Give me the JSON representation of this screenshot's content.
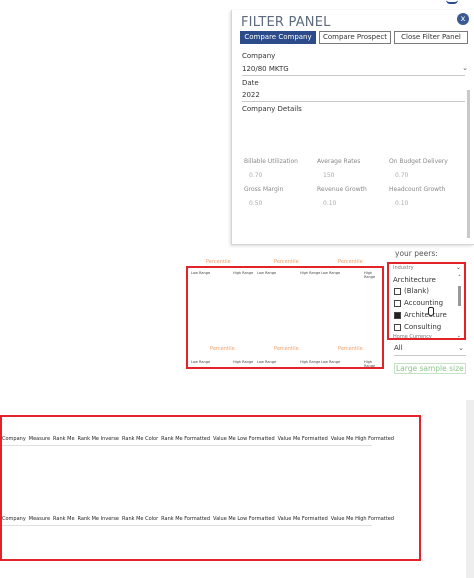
{
  "filter_panel": {
    "title": "FILTER PANEL",
    "close_label": "x",
    "tabs": [
      {
        "label": "Compare Company",
        "active": true
      },
      {
        "label": "Compare Prospect",
        "active": false
      },
      {
        "label": "Close Filter Panel",
        "active": false
      }
    ],
    "company_label": "Company",
    "company_value": "120/80 MKTG",
    "date_label": "Date",
    "date_value": "2022",
    "details_label": "Company Details",
    "metrics": [
      {
        "label": "Billable Utilization",
        "value": "0.70"
      },
      {
        "label": "Average Rates",
        "value": "150"
      },
      {
        "label": "On Budget Delivery",
        "value": "0.70"
      },
      {
        "label": "Gross Margin",
        "value": "0.50"
      },
      {
        "label": "Revenue Growth",
        "value": "0.10"
      },
      {
        "label": "Headcount Growth",
        "value": "0.10"
      }
    ]
  },
  "peers_text": "your peers:",
  "industry_filter": {
    "header": "Industry",
    "selected": "Architecture",
    "items": [
      {
        "label": "(Blank)",
        "checked": false
      },
      {
        "label": "Accounting",
        "checked": false
      },
      {
        "label": "Architecture",
        "checked": true
      },
      {
        "label": "Consulting",
        "checked": false
      }
    ],
    "footer_label": "Home Currency"
  },
  "all_select": "All",
  "large_sample": "Large sample size",
  "percentile_panel": {
    "percentile_label": "Percentile",
    "low_label": "Low Range",
    "high_label": "High Range"
  },
  "table_headers": [
    "Company",
    "Measure",
    "Rank Me",
    "Rank Me Inverse",
    "Rank Me Color",
    "Rank Me Formatted",
    "Value Me Low Formatted",
    "Value Me Formatted",
    "Value Me High Formatted"
  ],
  "colors": {
    "accent": "#2b4b8a",
    "highlight_red": "#e2232a",
    "percentile_orange": "#f0a068",
    "sample_green": "#8dc68b"
  }
}
